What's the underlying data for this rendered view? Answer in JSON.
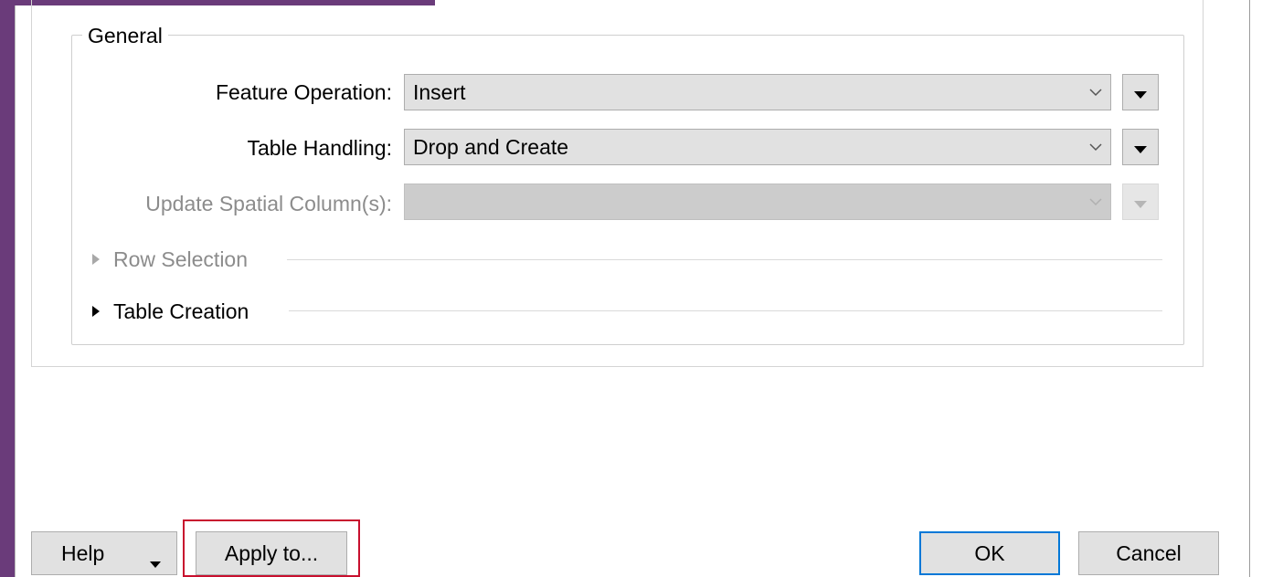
{
  "general": {
    "title": "General",
    "feature_operation": {
      "label": "Feature Operation:",
      "value": "Insert"
    },
    "table_handling": {
      "label": "Table Handling:",
      "value": "Drop and Create"
    },
    "update_spatial": {
      "label": "Update Spatial Column(s):",
      "value": ""
    },
    "row_selection": {
      "label": "Row Selection",
      "expanded": false,
      "enabled": false
    },
    "table_creation": {
      "label": "Table Creation",
      "expanded": false,
      "enabled": true
    }
  },
  "buttons": {
    "help": "Help",
    "apply_to": "Apply to...",
    "ok": "OK",
    "cancel": "Cancel"
  },
  "icons": {
    "chevron": "chevron-down-icon",
    "menu_arrow": "triangle-down-icon",
    "expand": "triangle-right-icon"
  },
  "colors": {
    "window_accent": "#6a3b7a",
    "default_button_border": "#0078d7",
    "highlight_border": "#c8102e"
  }
}
